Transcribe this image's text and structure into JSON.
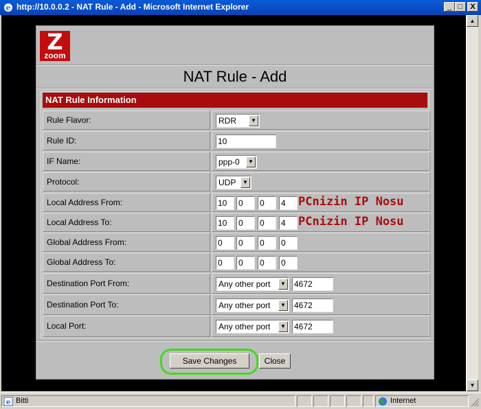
{
  "window": {
    "title": "http://10.0.0.2 - NAT Rule - Add - Microsoft Internet Explorer",
    "minimize": "_",
    "maximize": "□",
    "close": "X"
  },
  "logo": {
    "glyph": "Z",
    "word": "zoom",
    "color": "#c40d0d"
  },
  "page": {
    "title": "NAT Rule - Add",
    "section_header": "NAT Rule Information",
    "accent_color": "#a80d0d"
  },
  "form": {
    "rule_flavor": {
      "label": "Rule Flavor:",
      "value": "RDR"
    },
    "rule_id": {
      "label": "Rule ID:",
      "value": "10"
    },
    "if_name": {
      "label": "IF Name:",
      "value": "ppp-0"
    },
    "protocol": {
      "label": "Protocol:",
      "value": "UDP"
    },
    "local_from": {
      "label": "Local Address From:",
      "octets": [
        "10",
        "0",
        "0",
        "4"
      ],
      "note": "PCnizin IP Nosu"
    },
    "local_to": {
      "label": "Local Address To:",
      "octets": [
        "10",
        "0",
        "0",
        "4"
      ],
      "note": "PCnizin IP Nosu"
    },
    "global_from": {
      "label": "Global Address From:",
      "octets": [
        "0",
        "0",
        "0",
        "0"
      ]
    },
    "global_to": {
      "label": "Global Address To:",
      "octets": [
        "0",
        "0",
        "0",
        "0"
      ]
    },
    "dest_port_from": {
      "label": "Destination Port From:",
      "select": "Any other port",
      "port": "4672"
    },
    "dest_port_to": {
      "label": "Destination Port To:",
      "select": "Any other port",
      "port": "4672"
    },
    "local_port": {
      "label": "Local Port:",
      "select": "Any other port",
      "port": "4672"
    }
  },
  "buttons": {
    "save": "Save Changes",
    "close": "Close",
    "highlight_color": "#3fdc1a"
  },
  "statusbar": {
    "status": "Bitti",
    "zone": "Internet"
  }
}
